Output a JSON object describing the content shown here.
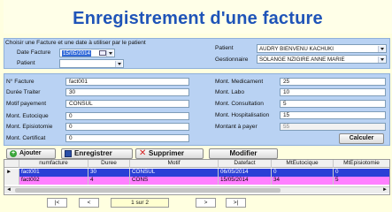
{
  "header": {
    "title": "Enregistrement d'une facture"
  },
  "filter": {
    "hint": "Choisir une Facture et une date à utiliser par le patient",
    "date_label": "Date Facture",
    "date_value": "15/05/2014",
    "patient_label": "Patient",
    "patient_value": "",
    "patient_right_label": "Patient",
    "patient_right_value": "AUDRY BIENVENU KACHUKI",
    "gestionnaire_label": "Gestionnaire",
    "gestionnaire_value": "SOLANGE NZIGIRE ANNE MARIE"
  },
  "form": {
    "facture_label": "N° Facture",
    "facture_value": "fact001",
    "duree_label": "Durée Traiter",
    "duree_value": "30",
    "motif_label": "Motif payement",
    "motif_value": "CONSUL",
    "eutocique_label": "Mont. Eutocique",
    "eutocique_value": "0",
    "episiotomie_label": "Mont. Episiotomie",
    "episiotomie_value": "0",
    "certificat_label": "Mont. Certificat",
    "certificat_value": "0",
    "medicament_label": "Mont. Medicament",
    "medicament_value": "25",
    "labo_label": "Mont. Labo",
    "labo_value": "10",
    "consultation_label": "Mont. Consultation",
    "consultation_value": "5",
    "hospitalisation_label": "Mont. Hospitalisation",
    "hospitalisation_value": "15",
    "payer_label": "Montant à payer",
    "payer_value": "55",
    "calculer_label": "Calculer"
  },
  "toolbar": {
    "ajouter": "Ajouter",
    "enregistrer": "Enregistrer",
    "supprimer": "Supprimer",
    "modifier": "Modifier"
  },
  "grid": {
    "columns": [
      "numfacture",
      "Duree",
      "Motif",
      "Datefact",
      "MtEutocique",
      "MtEpisiotomie"
    ],
    "rows": [
      [
        "fact001",
        "30",
        "CONSUL",
        "06/05/2014",
        "0",
        "0"
      ],
      [
        "fact002",
        "4",
        "CONS",
        "15/05/2014",
        "34",
        "5"
      ]
    ]
  },
  "pager": {
    "first": "|<",
    "prev": "<",
    "page": "1 sur 2",
    "next": ">",
    "last": ">|"
  },
  "colors": {
    "title": "#1f54b8",
    "panel": "#b9d2f3",
    "selected_row": "#2a3fd6",
    "second_row": "#ff80ff",
    "background": "#ffffe0"
  }
}
